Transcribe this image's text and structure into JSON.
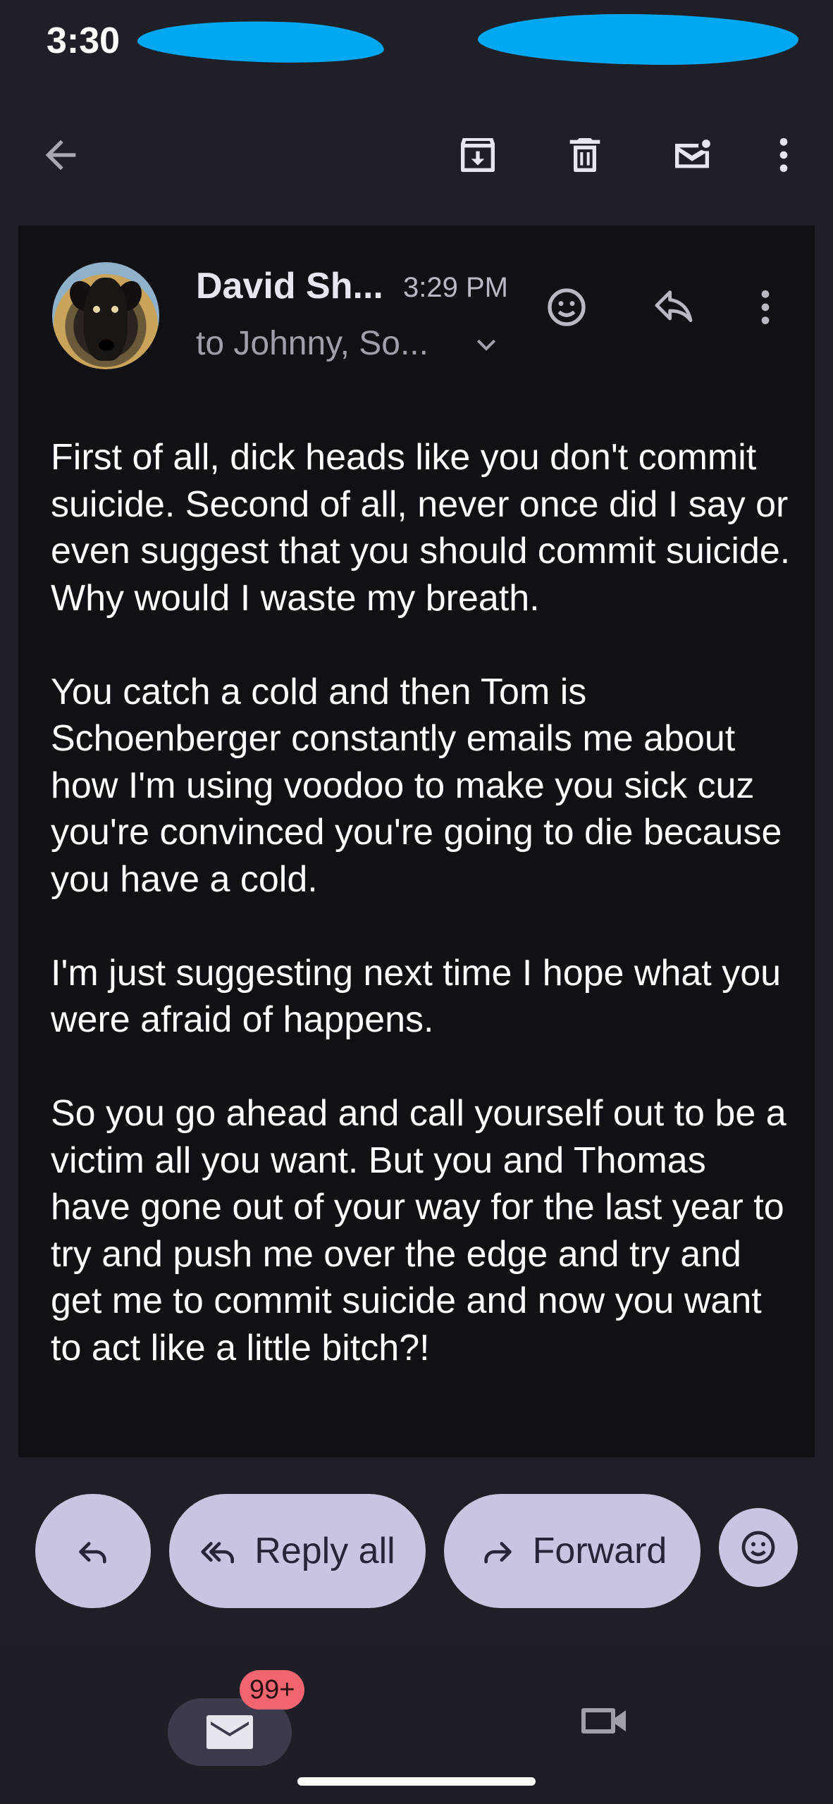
{
  "status_bar": {
    "time": "3:30"
  },
  "toolbar": {
    "icons": [
      "back-arrow-icon",
      "archive-icon",
      "trash-icon",
      "mark-unread-icon",
      "more-vert-icon"
    ]
  },
  "message": {
    "sender": "David Sh...",
    "time": "3:29 PM",
    "recipients": "to Johnny, So...",
    "body": [
      "First of all, dick heads like you don't commit suicide. Second of all, never once did I say or even suggest that you should commit suicide. Why would I waste my breath.",
      "You catch a cold and then Tom is Schoenberger constantly emails me about how I'm using voodoo to make you sick cuz you're convinced you're going to die because you have a cold.",
      "I'm just suggesting next time I hope what you were afraid of happens.",
      "So you go ahead and call yourself out to be a victim all you want. But you and Thomas have gone out of your way for the last year to try and push me over the edge and try and get me to commit suicide and now you want to act like a little bitch?!"
    ]
  },
  "actions": {
    "reply_all_label": "Reply all",
    "forward_label": "Forward"
  },
  "bottom_nav": {
    "mail_badge": "99+"
  },
  "colors": {
    "background": "#1f2027",
    "card": "#111115",
    "pill": "#c9c5e0",
    "badge": "#f0656f",
    "redaction": "#00a8f3"
  }
}
